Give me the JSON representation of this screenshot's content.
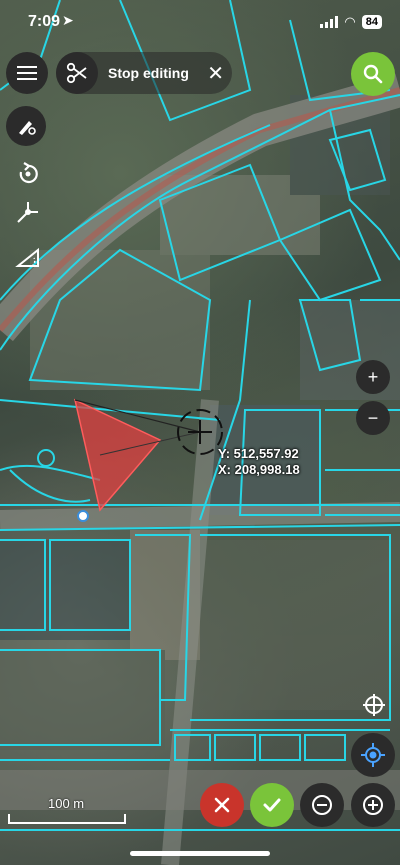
{
  "status_bar": {
    "time": "7:09",
    "battery": "84"
  },
  "toolbar": {
    "menu_icon": "menu-icon",
    "scissors_icon": "scissors-icon",
    "stop_editing_label": "Stop editing",
    "close_icon": "close-icon"
  },
  "search": {
    "icon": "search-icon"
  },
  "side_tools": [
    "edit-style-icon",
    "rotate-icon",
    "vertex-icon",
    "measure-angle-icon"
  ],
  "coordinates": {
    "y_label": "Y: 512,557.92",
    "x_label": "X: 208,998.18"
  },
  "zoom": {
    "in_label": "+",
    "out_label": "−"
  },
  "scale": {
    "label": "100 m"
  },
  "bottom_actions": {
    "cancel_icon": "cancel-icon",
    "confirm_icon": "check-icon",
    "zoom_out_icon": "zoom-out-icon",
    "zoom_in_icon": "zoom-in-icon"
  },
  "colors": {
    "accent_green": "#7ac43a",
    "cancel_red": "#c9342b",
    "parcel_lines": "#28d6e6",
    "polygon_fill": "#e04040"
  }
}
